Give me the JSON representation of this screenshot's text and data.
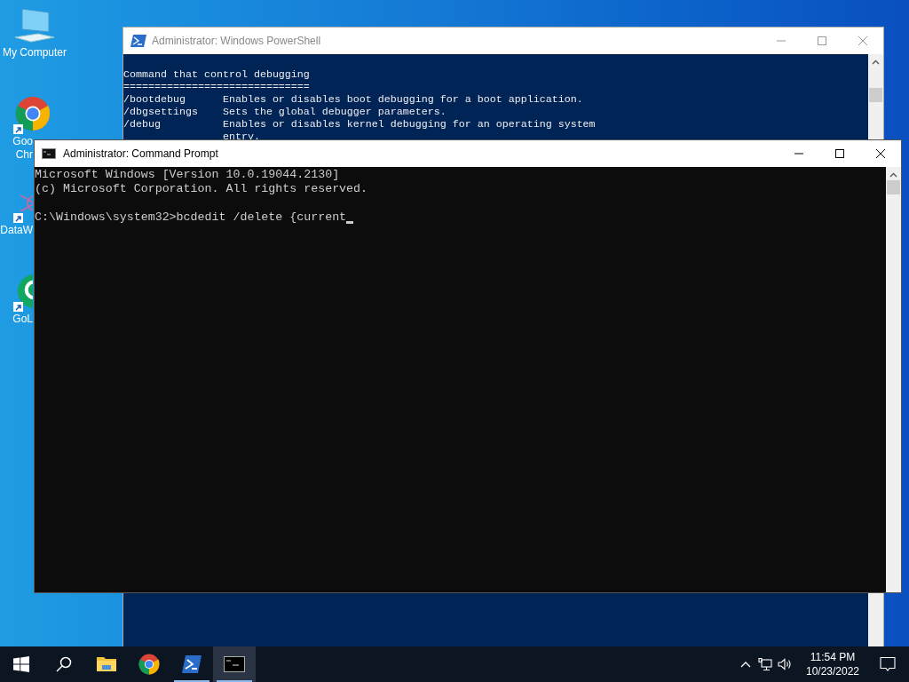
{
  "desktop_icons": [
    {
      "kind": "computer",
      "label_lines": [
        "My Computer"
      ]
    },
    {
      "kind": "chrome",
      "label_lines": [
        "Goo",
        "Chr"
      ]
    },
    {
      "kind": "grid-app",
      "label_lines": [
        "DataW"
      ]
    },
    {
      "kind": "green-app",
      "label_lines": [
        "GoL"
      ]
    }
  ],
  "windows": [
    {
      "kind": "powershell",
      "title": "Administrator: Windows PowerShell",
      "active": false,
      "paragraphs": [
        [
          "Command that control debugging",
          "==============================",
          "/bootdebug      Enables or disables boot debugging for a boot application.",
          "/dbgsettings    Sets the global debugger parameters.",
          "/debug          Enables or disables kernel debugging for an operating system",
          "                entry."
        ]
      ]
    },
    {
      "kind": "cmd",
      "title": "Administrator: Command Prompt",
      "active": true,
      "paragraphs": [
        [
          "Microsoft Windows [Version 10.0.19044.2130]",
          "(c) Microsoft Corporation. All rights reserved."
        ],
        [
          "C:\\Windows\\system32>bcdedit /delete {current"
        ]
      ]
    }
  ],
  "taskbar": {
    "apps": [
      {
        "kind": "explorer",
        "open": false,
        "selected": false
      },
      {
        "kind": "chrome",
        "open": false,
        "selected": false
      },
      {
        "kind": "powershell",
        "open": true,
        "selected": false
      },
      {
        "kind": "cmd",
        "open": true,
        "selected": true
      }
    ],
    "time": "11:54 PM",
    "date": "10/23/2022"
  }
}
